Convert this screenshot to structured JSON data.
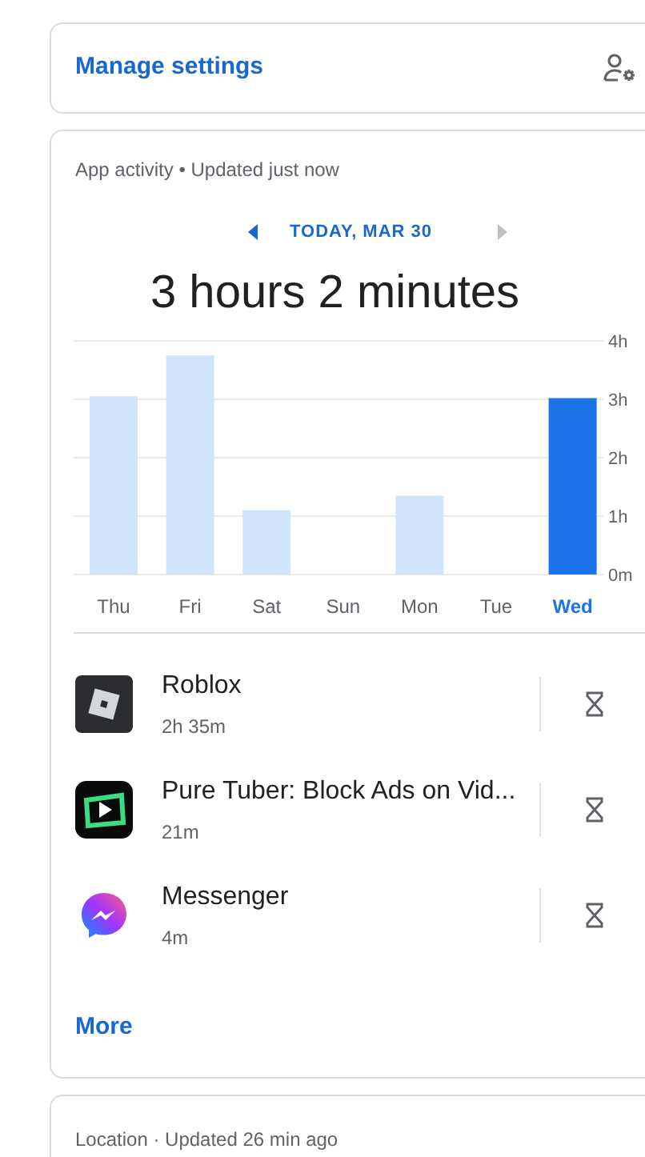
{
  "manage_settings": {
    "label": "Manage settings"
  },
  "app_activity": {
    "header": "App activity • Updated just now",
    "date_nav": {
      "label": "TODAY, MAR 30",
      "prev_disabled": false,
      "next_disabled": true
    },
    "total": "3 hours 2 minutes",
    "chart_data": {
      "type": "bar",
      "categories": [
        "Thu",
        "Fri",
        "Sat",
        "Sun",
        "Mon",
        "Tue",
        "Wed"
      ],
      "series": [
        {
          "color": "#d2e3fc",
          "values": [
            3.05,
            3.75,
            1.1,
            0,
            1.35,
            0,
            null
          ]
        },
        {
          "color": "#1a73e8",
          "values": [
            null,
            null,
            null,
            null,
            null,
            null,
            3.02
          ]
        }
      ],
      "grid": true,
      "ylim": [
        0,
        4
      ],
      "yticks": [
        {
          "value": 0,
          "label": "0m"
        },
        {
          "value": 1,
          "label": "1h"
        },
        {
          "value": 2,
          "label": "2h"
        },
        {
          "value": 3,
          "label": "3h"
        },
        {
          "value": 4,
          "label": "4h"
        }
      ]
    },
    "apps": [
      {
        "name": "Roblox",
        "time": "2h 35m",
        "kind": "roblox"
      },
      {
        "name": "Pure Tuber: Block Ads on Vid...",
        "time": "21m",
        "kind": "puretuber"
      },
      {
        "name": "Messenger",
        "time": "4m",
        "kind": "messenger"
      }
    ],
    "more": "More"
  },
  "location": {
    "header": "Location · Updated 26 min ago"
  }
}
